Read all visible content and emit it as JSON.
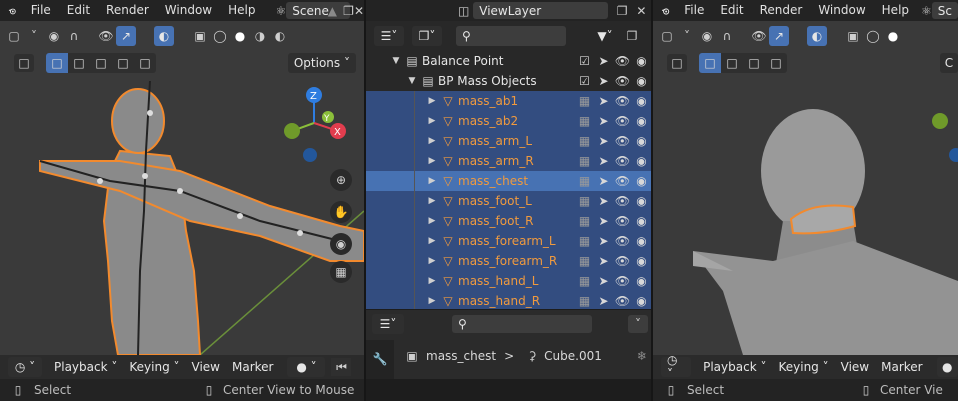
{
  "left": {
    "menu": [
      "File",
      "Edit",
      "Render",
      "Window",
      "Help"
    ],
    "scene_label": "Scene",
    "options_label": "Options",
    "bottom": {
      "playback": "Playback",
      "keying": "Keying",
      "view": "View",
      "marker": "Marker"
    },
    "status": {
      "select": "Select",
      "center": "Center View to Mouse"
    }
  },
  "middle": {
    "viewlayer_label": "ViewLayer",
    "outliner": {
      "rows": [
        {
          "name": "Balance Point",
          "kind": "collection",
          "selected": false
        },
        {
          "name": "BP Mass Objects",
          "kind": "collection",
          "selected": false
        },
        {
          "name": "mass_ab1",
          "kind": "object",
          "selected": true
        },
        {
          "name": "mass_ab2",
          "kind": "object",
          "selected": true
        },
        {
          "name": "mass_arm_L",
          "kind": "object",
          "selected": true
        },
        {
          "name": "mass_arm_R",
          "kind": "object",
          "selected": true
        },
        {
          "name": "mass_chest",
          "kind": "object",
          "selected": true,
          "active": true
        },
        {
          "name": "mass_foot_L",
          "kind": "object",
          "selected": true
        },
        {
          "name": "mass_foot_R",
          "kind": "object",
          "selected": true
        },
        {
          "name": "mass_forearm_L",
          "kind": "object",
          "selected": true
        },
        {
          "name": "mass_forearm_R",
          "kind": "object",
          "selected": true
        },
        {
          "name": "mass_hand_L",
          "kind": "object",
          "selected": true
        },
        {
          "name": "mass_hand_R",
          "kind": "object",
          "selected": true
        }
      ]
    },
    "properties": {
      "object": "mass_chest",
      "data": "Cube.001"
    }
  },
  "right": {
    "menu": [
      "File",
      "Edit",
      "Render",
      "Window",
      "Help"
    ],
    "scene_label": "Sc",
    "options_label": "C",
    "bottom": {
      "playback": "Playback",
      "keying": "Keying",
      "view": "View",
      "marker": "Marker"
    },
    "status": {
      "select": "Select",
      "center": "Center Vie"
    }
  },
  "colors": {
    "accent": "#4772b3",
    "selection": "#f28a2e",
    "viewport_bg": "#3a3a3a",
    "axis_x": "#e23d4e",
    "axis_y": "#8bbf3a",
    "axis_z": "#2f7de0"
  }
}
